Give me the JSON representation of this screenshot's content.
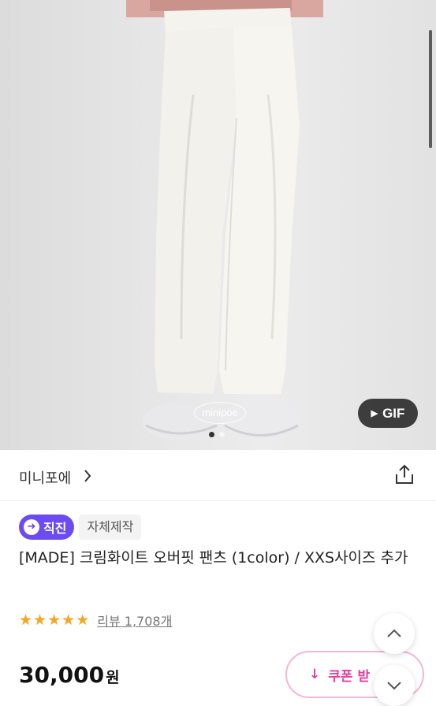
{
  "photo": {
    "watermark": "minipoe",
    "gif_label": "GIF",
    "gif_play_glyph": "▶",
    "slide_count": 2,
    "active_slide": 1
  },
  "store": {
    "name": "미니포에",
    "chevron": "chevron-right-icon",
    "share": "share-icon"
  },
  "badges": {
    "direct": "직진",
    "direct_icon": "➜",
    "own": "자체제작"
  },
  "product": {
    "title": "[MADE] 크림화이트 오버핏 팬츠 (1color) / XXS사이즈 추가"
  },
  "rating": {
    "stars": 5,
    "star_glyph": "★",
    "review_link": "리뷰 1,708개"
  },
  "price": {
    "amount": "30,000",
    "unit": "원"
  },
  "coupon": {
    "icon": "↓",
    "label": "쿠폰 받"
  },
  "colors": {
    "accent_purple": "#6c4bf5",
    "star": "#f5a623",
    "coupon_pink": "#e33fa0"
  }
}
